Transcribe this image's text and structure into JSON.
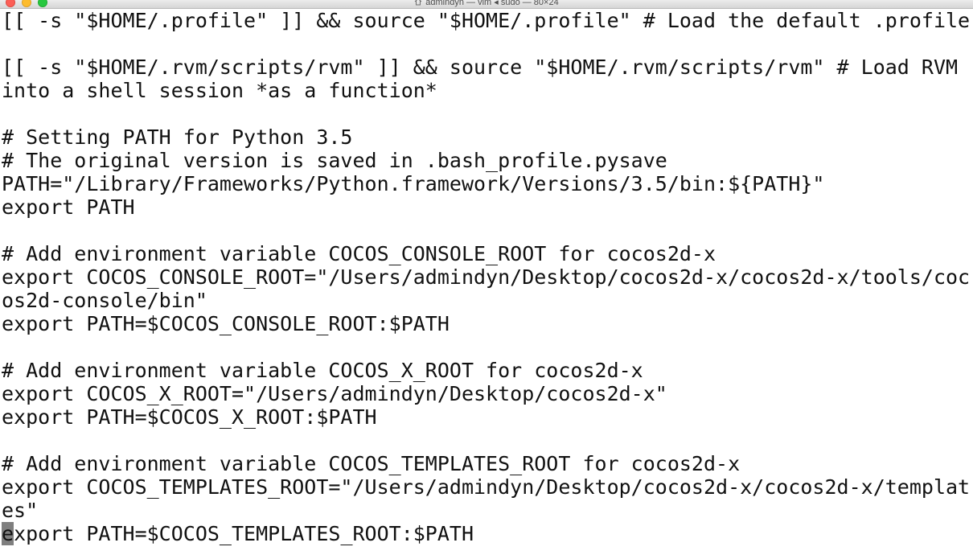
{
  "window": {
    "title": "admindyn — vim ◂ sudo — 80×24"
  },
  "terminal": {
    "lines": [
      "[[ -s \"$HOME/.profile\" ]] && source \"$HOME/.profile\" # Load the default .profile",
      "",
      "[[ -s \"$HOME/.rvm/scripts/rvm\" ]] && source \"$HOME/.rvm/scripts/rvm\" # Load RVM",
      "into a shell session *as a function*",
      "",
      "# Setting PATH for Python 3.5",
      "# The original version is saved in .bash_profile.pysave",
      "PATH=\"/Library/Frameworks/Python.framework/Versions/3.5/bin:${PATH}\"",
      "export PATH",
      "",
      "# Add environment variable COCOS_CONSOLE_ROOT for cocos2d-x",
      "export COCOS_CONSOLE_ROOT=\"/Users/admindyn/Desktop/cocos2d-x/cocos2d-x/tools/coc",
      "os2d-console/bin\"",
      "export PATH=$COCOS_CONSOLE_ROOT:$PATH",
      "",
      "# Add environment variable COCOS_X_ROOT for cocos2d-x",
      "export COCOS_X_ROOT=\"/Users/admindyn/Desktop/cocos2d-x\"",
      "export PATH=$COCOS_X_ROOT:$PATH",
      "",
      "# Add environment variable COCOS_TEMPLATES_ROOT for cocos2d-x",
      "export COCOS_TEMPLATES_ROOT=\"/Users/admindyn/Desktop/cocos2d-x/cocos2d-x/templat",
      "es\""
    ],
    "cursor_line": {
      "cursor_char": "e",
      "rest": "xport PATH=$COCOS_TEMPLATES_ROOT:$PATH"
    }
  }
}
